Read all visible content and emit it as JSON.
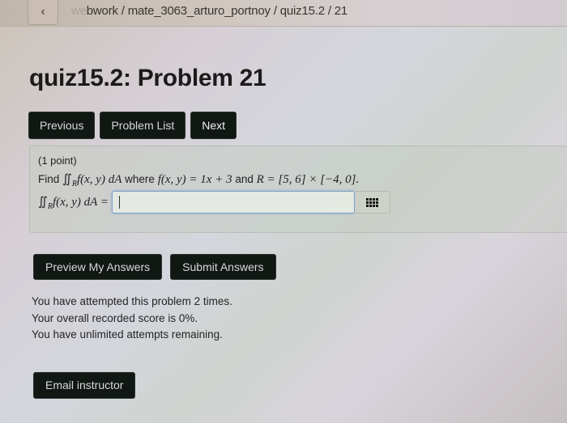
{
  "topbar": {
    "back_icon": "chevron-left-icon",
    "breadcrumb_prefix": "we",
    "breadcrumb_rest": "bwork / mate_3063_arturo_portnoy / quiz15.2 / 21"
  },
  "page": {
    "title": "quiz15.2: Problem 21"
  },
  "nav": {
    "previous_label": "Previous",
    "problem_list_label": "Problem List",
    "next_label": "Next"
  },
  "problem": {
    "points": "(1 point)",
    "find_label": "Find",
    "integral_symbol": "∬",
    "region_symbol": "R",
    "integrand": "f(x, y) dA",
    "where_label": "where",
    "function_def": "f(x, y) = 1x + 3",
    "and_label": "and",
    "region_def": "R = [5, 6] × [−4, 0].",
    "answer_prompt_integrand": "f(x, y) dA =",
    "answer_value": "",
    "palette_icon": "equation-palette-grid-icon"
  },
  "actions": {
    "preview_label": "Preview My Answers",
    "submit_label": "Submit Answers",
    "email_label": "Email instructor"
  },
  "status": {
    "attempts": "You have attempted this problem 2 times.",
    "score": "Your overall recorded score is 0%.",
    "remaining": "You have unlimited attempts remaining."
  },
  "colors": {
    "button_bg": "#111814",
    "input_border": "#7b9fc9"
  }
}
